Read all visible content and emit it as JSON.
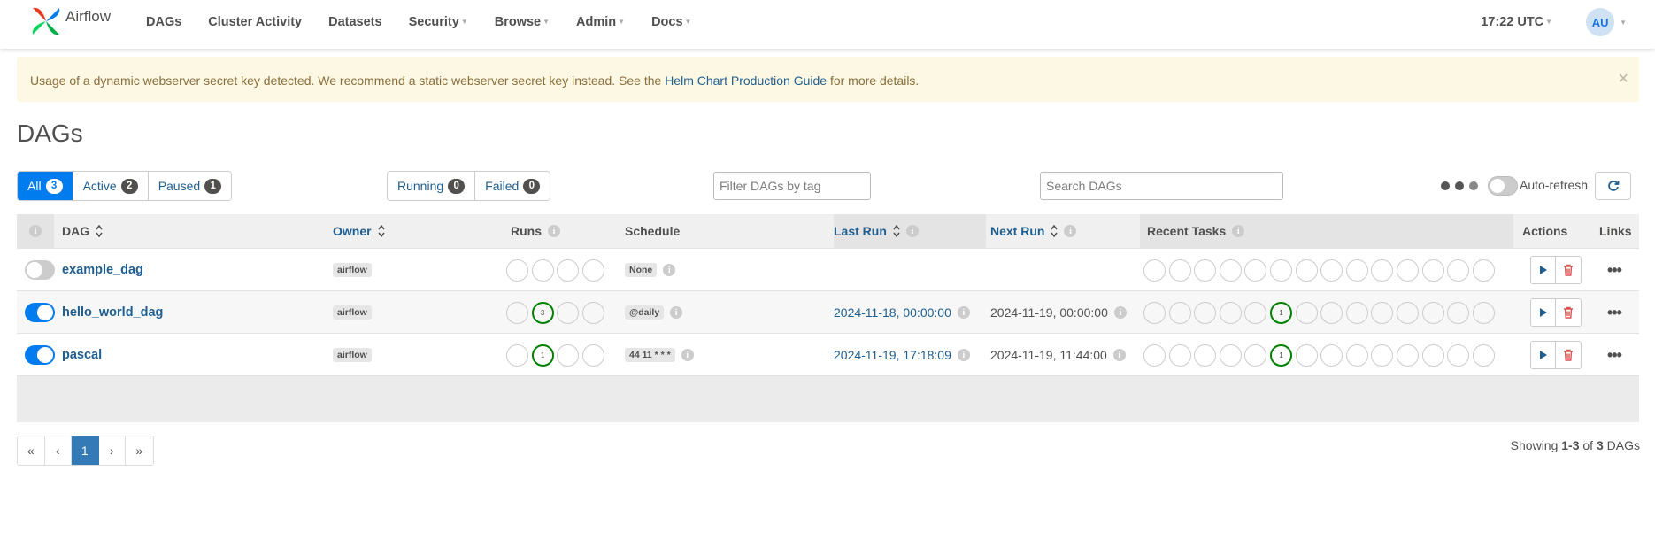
{
  "nav": {
    "brand": "Airflow",
    "items": [
      {
        "label": "DAGs",
        "caret": false
      },
      {
        "label": "Cluster Activity",
        "caret": false
      },
      {
        "label": "Datasets",
        "caret": false
      },
      {
        "label": "Security",
        "caret": true
      },
      {
        "label": "Browse",
        "caret": true
      },
      {
        "label": "Admin",
        "caret": true
      },
      {
        "label": "Docs",
        "caret": true
      }
    ],
    "time": "17:22 UTC",
    "user_initials": "AU"
  },
  "alert": {
    "text_before": "Usage of a dynamic webserver secret key detected. We recommend a static webserver secret key instead. See the ",
    "link": "Helm Chart Production Guide",
    "text_after": " for more details.",
    "close": "×"
  },
  "page_title": "DAGs",
  "status_filters": [
    {
      "label": "All",
      "count": "3",
      "active": true
    },
    {
      "label": "Active",
      "count": "2",
      "active": false
    },
    {
      "label": "Paused",
      "count": "1",
      "active": false
    }
  ],
  "run_filters": [
    {
      "label": "Running",
      "count": "0"
    },
    {
      "label": "Failed",
      "count": "0"
    }
  ],
  "tag_filter": {
    "placeholder": "Filter DAGs by tag"
  },
  "search": {
    "placeholder": "Search DAGs"
  },
  "auto_refresh": {
    "label": "Auto-refresh",
    "enabled": false
  },
  "table": {
    "headers": {
      "info": "i",
      "dag": "DAG",
      "owner": "Owner",
      "runs": "Runs",
      "schedule": "Schedule",
      "last_run": "Last Run",
      "next_run": "Next Run",
      "recent_tasks": "Recent Tasks",
      "actions": "Actions",
      "links": "Links"
    },
    "rows": [
      {
        "paused": true,
        "dag_id": "example_dag",
        "owner": "airflow",
        "runs": [
          null,
          null,
          null,
          null
        ],
        "schedule": "None",
        "last_run": "",
        "next_run": "",
        "recent_tasks": [
          null,
          null,
          null,
          null,
          null,
          null,
          null,
          null,
          null,
          null,
          null,
          null,
          null,
          null
        ]
      },
      {
        "paused": false,
        "dag_id": "hello_world_dag",
        "owner": "airflow",
        "runs": [
          null,
          "3",
          null,
          null
        ],
        "schedule": "@daily",
        "last_run": "2024-11-18, 00:00:00",
        "next_run": "2024-11-19, 00:00:00",
        "recent_tasks": [
          null,
          null,
          null,
          null,
          null,
          "1",
          null,
          null,
          null,
          null,
          null,
          null,
          null,
          null
        ]
      },
      {
        "paused": false,
        "dag_id": "pascal",
        "owner": "airflow",
        "runs": [
          null,
          "1",
          null,
          null
        ],
        "schedule": "44 11 * * *",
        "last_run": "2024-11-19, 17:18:09",
        "next_run": "2024-11-19, 11:44:00",
        "recent_tasks": [
          null,
          null,
          null,
          null,
          null,
          "1",
          null,
          null,
          null,
          null,
          null,
          null,
          null,
          null
        ]
      }
    ]
  },
  "pagination": {
    "items": [
      "«",
      "‹",
      "1",
      "›",
      "»"
    ],
    "active": "1"
  },
  "showing": {
    "prefix": "Showing ",
    "range": "1-3",
    "mid": " of ",
    "total": "3",
    "suffix": " DAGs"
  },
  "colors": {
    "primary": "#017cee",
    "link": "#1f5e91",
    "success": "#008000",
    "alert_bg": "#fcf8e3",
    "danger": "#d9534f"
  }
}
